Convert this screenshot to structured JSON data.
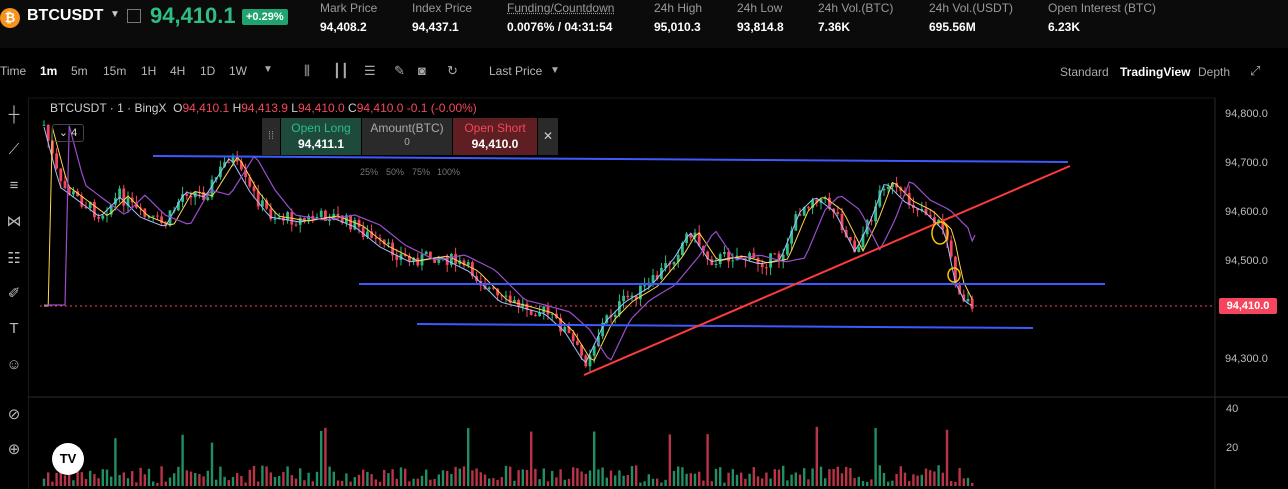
{
  "header": {
    "logo": "₿",
    "symbol": "BTCUSDT",
    "last_price": "94,410.1",
    "change": "+0.29%",
    "stats": [
      {
        "label": "Mark Price",
        "value": "94,408.2"
      },
      {
        "label": "Index Price",
        "value": "94,437.1"
      },
      {
        "label": "Funding/Countdown",
        "value": "0.0076% / 04:31:54"
      },
      {
        "label": "24h High",
        "value": "95,010.3"
      },
      {
        "label": "24h Low",
        "value": "93,814.8"
      },
      {
        "label": "24h Vol.(BTC)",
        "value": "7.36K"
      },
      {
        "label": "24h Vol.(USDT)",
        "value": "695.56M"
      },
      {
        "label": "Open Interest (BTC)",
        "value": "6.23K"
      }
    ]
  },
  "toolbar": {
    "timeframes": [
      "Time",
      "1m",
      "5m",
      "15m",
      "1H",
      "4H",
      "1D",
      "1W"
    ],
    "active_timeframe": "1m",
    "price_type": "Last Price",
    "views": [
      "Standard",
      "TradingView",
      "Depth"
    ],
    "active_view": "TradingView"
  },
  "chart_info": {
    "title": "BTCUSDT · 1 · BingX",
    "o_label": "O",
    "o": "94,410.1",
    "h_label": "H",
    "h": "94,413.9",
    "l_label": "L",
    "l": "94,410.0",
    "c_label": "C",
    "c": "94,410.0",
    "delta": "-0.1 (-0.00%)",
    "indicators_count": "4"
  },
  "order_panel": {
    "long_label": "Open Long",
    "long_price": "94,411.1",
    "amount_label": "Amount(BTC)",
    "amount_value": "0",
    "short_label": "Open Short",
    "short_price": "94,410.0",
    "percents": [
      "25%",
      "50%",
      "75%",
      "100%"
    ]
  },
  "price_axis": [
    "94,800.0",
    "94,700.0",
    "94,600.0",
    "94,500.0",
    "94,300.0"
  ],
  "current_price_label": "94,410.0",
  "volume_axis": [
    "40",
    "20"
  ],
  "colors": {
    "up": "#2ebd85",
    "down": "#f6465d",
    "trendline": "#3d5afe",
    "redline": "#ff3b3b"
  }
}
